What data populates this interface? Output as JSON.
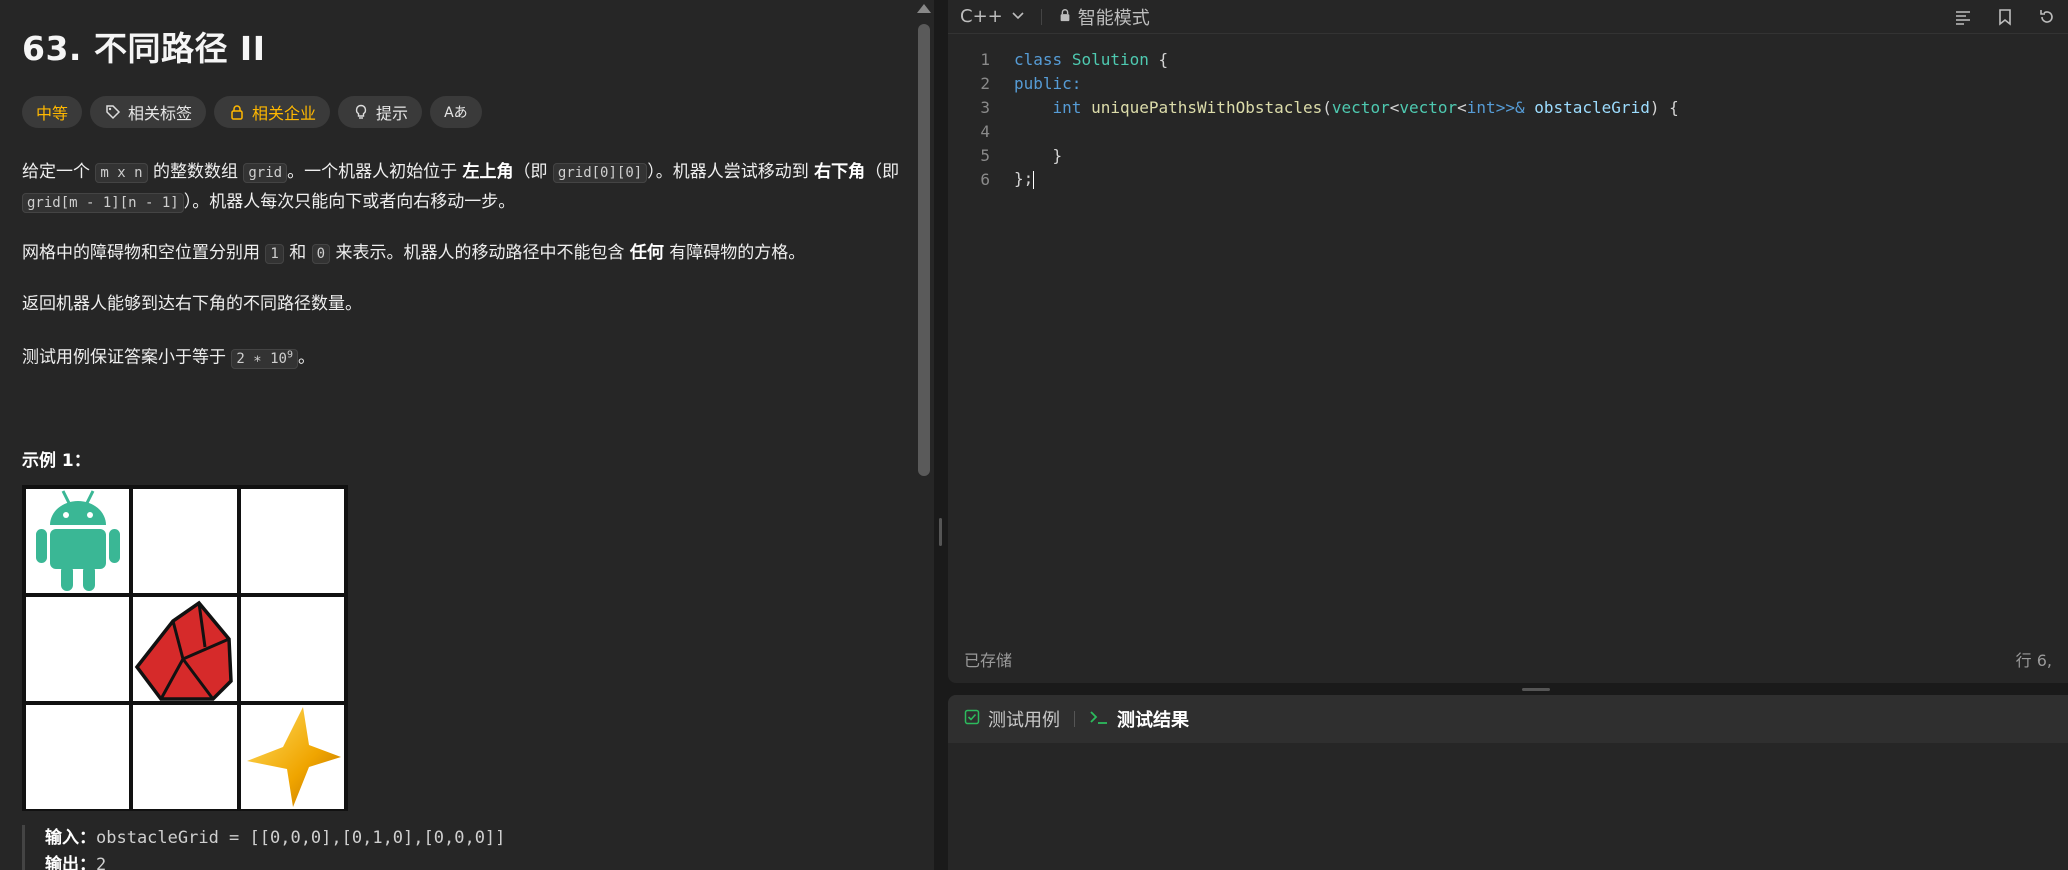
{
  "problem": {
    "title": "63. 不同路径 II",
    "tags": {
      "difficulty": "中等",
      "related_tags": "相关标签",
      "related_company": "相关企业",
      "hint": "提示",
      "translate": "Aあ"
    },
    "p1": {
      "t1": "给定一个 ",
      "c1": "m x n",
      "t2": " 的整数数组 ",
      "c2": "grid",
      "t3": "。一个机器人初始位于 ",
      "b1": "左上角",
      "t4": "（即 ",
      "c3": "grid[0][0]",
      "t5": "）。机器人尝试移动到 ",
      "b2": "右下角",
      "t6": "（即 ",
      "c4": "grid[m - 1][n - 1]",
      "t7": "）。机器人每次只能向下或者向右移动一步。"
    },
    "p2": {
      "t1": "网格中的障碍物和空位置分别用 ",
      "c1": "1",
      "t2": " 和 ",
      "c2": "0",
      "t3": " 来表示。机器人的移动路径中不能包含 ",
      "b1": "任何",
      "t4": " 有障碍物的方格。"
    },
    "p3": "返回机器人能够到达右下角的不同路径数量。",
    "p4": {
      "t1": "测试用例保证答案小于等于 ",
      "c1": "2 ∗ 10",
      "sup": "9",
      "t2": "。"
    },
    "example1": {
      "title": "示例 1：",
      "input_label": "输入：",
      "input_value": "obstacleGrid = [[0,0,0],[0,1,0],[0,0,0]]",
      "output_label": "输出：",
      "output_value": "2"
    }
  },
  "editor": {
    "language": "C++",
    "mode": "智能模式",
    "lines": [
      {
        "num": "1"
      },
      {
        "num": "2"
      },
      {
        "num": "3"
      },
      {
        "num": "4"
      },
      {
        "num": "5"
      },
      {
        "num": "6"
      }
    ],
    "code": {
      "l1a": "class",
      "l1b": "Solution",
      "l1c": " {",
      "l2": "public:",
      "l3a": "int",
      "l3b": "uniquePathsWithObstacles",
      "l3c": "(",
      "l3d": "vector",
      "l3e": "<",
      "l3f": "vector",
      "l3g": "<",
      "l3h": "int",
      "l3i": ">>&",
      "l3j": "obstacleGrid",
      "l3k": ") {",
      "l5": "}",
      "l6": "};"
    },
    "saved": "已存储",
    "position": "行 6,"
  },
  "testpanel": {
    "tab_cases": "测试用例",
    "tab_results": "测试结果"
  },
  "colors": {
    "difficulty": "#ffb800",
    "keyword": "#569cd6",
    "type": "#4ec9b0",
    "function": "#dcdcaa",
    "variable": "#9cdcfe",
    "check": "#2cbb5d"
  }
}
